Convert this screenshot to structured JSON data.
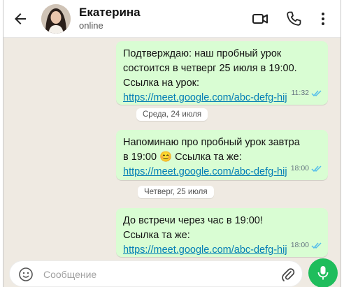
{
  "header": {
    "name": "Екатерина",
    "status": "online",
    "icons": [
      "back-arrow-icon",
      "video-call-icon",
      "phone-icon",
      "more-vert-icon"
    ]
  },
  "messages": [
    {
      "lines": [
        "Подтверждаю: наш пробный урок",
        "состоится в четверг 25 июля в 19:00.",
        "Ссылка на урок:"
      ],
      "link": "https://meet.google.com/abc-defg-hij",
      "time": "11:32"
    },
    {
      "lines": [
        "Напоминаю про пробный урок завтра",
        "в 19:00 😊 Ссылка та же:"
      ],
      "link": "https://meet.google.com/abc-defg-hij",
      "time": "18:00"
    },
    {
      "lines": [
        "До встречи через час в 19:00!",
        "Ссылка та же:"
      ],
      "link": "https://meet.google.com/abc-defg-hij",
      "time": "18:00"
    }
  ],
  "day_dividers": [
    "Среда, 24 июля",
    "Четверг, 25 июля"
  ],
  "composer": {
    "placeholder": "Сообщение",
    "icons": [
      "emoji-icon",
      "attach-icon",
      "mic-icon"
    ]
  },
  "colors": {
    "outgoing_bubble": "#d9fdd3",
    "chat_background": "#efeae2",
    "link": "#027eb5",
    "read_check": "#53bdeb",
    "mic_button": "#1fbd5c"
  }
}
